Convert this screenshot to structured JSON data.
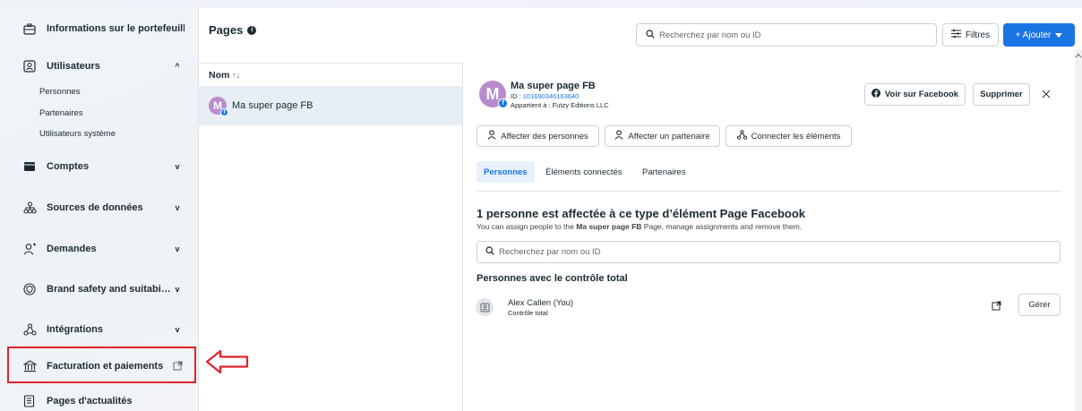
{
  "sidebar": {
    "items": [
      {
        "label": "Informations sur le portefeuill…",
        "icon": "briefcase-info-icon"
      },
      {
        "label": "Utilisateurs",
        "icon": "users-icon",
        "chevron": "^"
      },
      {
        "label": "Comptes",
        "icon": "folder-icon",
        "chevron": "v"
      },
      {
        "label": "Sources de données",
        "icon": "data-sources-icon",
        "chevron": "v"
      },
      {
        "label": "Demandes",
        "icon": "requests-icon",
        "chevron": "v"
      },
      {
        "label": "Brand safety and suitabi…",
        "icon": "shield-icon",
        "chevron": "v"
      },
      {
        "label": "Intégrations",
        "icon": "integrations-icon",
        "chevron": "v"
      },
      {
        "label": "Facturation et paiements",
        "icon": "bank-icon"
      },
      {
        "label": "Pages d'actualités",
        "icon": "news-page-icon"
      }
    ],
    "sub_items": [
      "Personnes",
      "Partenaires",
      "Utilisateurs système"
    ]
  },
  "header": {
    "title": "Pages",
    "info": "i",
    "search_placeholder": "Recherchez par nom ou ID",
    "filters_label": "Filtres",
    "add_label": "+ Ajouter"
  },
  "list": {
    "column_header": "Nom",
    "sort_glyph": "↑↓",
    "rows": [
      {
        "name": "Ma super page FB",
        "avatar_letter": "M"
      }
    ]
  },
  "detail": {
    "page_name": "Ma super page FB",
    "avatar_letter": "M",
    "id_label": "ID :",
    "id_value": "101690346163640",
    "owner": "Appartient à : Futzy Editions LLC",
    "view_button": "Voir sur Facebook",
    "delete_button": "Supprimer",
    "actions": [
      "Affecter des personnes",
      "Affecter un partenaire",
      "Connecter les éléments"
    ],
    "tabs": [
      "Personnes",
      "Éléments connectés",
      "Partenaires"
    ],
    "heading": "1 personne est affectée à ce type d’élément Page Facebook",
    "subheading_pre": "You can assign people to the ",
    "subheading_bold": "Ma super page FB",
    "subheading_post": " Page, manage assignments and remove them.",
    "search_placeholder": "Recherchez par nom ou ID",
    "full_control_heading": "Personnes avec le contrôle total",
    "person_name": "Alex Callen (You)",
    "person_role": "Contrôle total",
    "manage_button": "Gérer"
  },
  "colors": {
    "accent": "#1b74e4",
    "highlight": "#e0242a",
    "avatar": "#b98bcc"
  }
}
